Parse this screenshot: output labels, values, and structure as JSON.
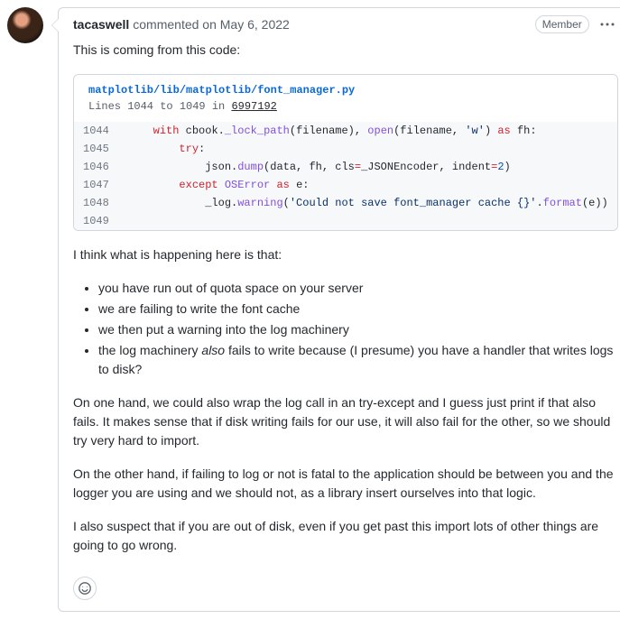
{
  "author": "tacaswell",
  "meta_text": "commented on May 6, 2022",
  "badge": "Member",
  "intro": "This is coming from this code:",
  "code_ref": {
    "path": "matplotlib/lib/matplotlib/font_manager.py",
    "lines_prefix": "Lines 1044 to 1049 in ",
    "sha": "6997192"
  },
  "code_lines": [
    {
      "n": "1044"
    },
    {
      "n": "1045"
    },
    {
      "n": "1046"
    },
    {
      "n": "1047"
    },
    {
      "n": "1048"
    },
    {
      "n": "1049"
    }
  ],
  "code": {
    "l0": {
      "t0": "    ",
      "k0": "with",
      "t1": " cbook.",
      "fn0": "_lock_path",
      "t2": "(filename), ",
      "fn1": "open",
      "t3": "(filename, ",
      "s0": "'w'",
      "t4": ") ",
      "k1": "as",
      "t5": " fh:"
    },
    "l1": {
      "t0": "        ",
      "k0": "try",
      "t1": ":"
    },
    "l2": {
      "t0": "            json.",
      "fn0": "dump",
      "t1": "(data, fh, cls",
      "op": "=",
      "t2": "_JSONEncoder, indent",
      "op2": "=",
      "c0": "2",
      "t3": ")"
    },
    "l3": {
      "t0": "        ",
      "k0": "except",
      "t1": " ",
      "cls": "OSError",
      "t2": " ",
      "k1": "as",
      "t3": " e:"
    },
    "l4": {
      "t0": "            _log.",
      "fn0": "warning",
      "t1": "(",
      "s0": "'Could not save font_manager cache {}'",
      "t2": ".",
      "fn1": "format",
      "t3": "(e))"
    },
    "l5": {
      "t0": ""
    }
  },
  "para1": "I think what is happening here is that:",
  "bullets": {
    "b0": "you have run out of quota space on your server",
    "b1": "we are failing to write the font cache",
    "b2": "we then put a warning into the log machinery",
    "b3_a": "the log machinery ",
    "b3_em": "also",
    "b3_b": " fails to write because (I presume) you have a handler that writes logs to disk?"
  },
  "para2": "On one hand, we could also wrap the log call in an try-except and I guess just print if that also fails. It makes sense that if disk writing fails for our use, it will also fail for the other, so we should try very hard to import.",
  "para3": "On the other hand, if failing to log or not is fatal to the application should be between you and the logger you are using and we should not, as a library insert ourselves into that logic.",
  "para4": "I also suspect that if you are out of disk, even if you get past this import lots of other things are going to go wrong."
}
